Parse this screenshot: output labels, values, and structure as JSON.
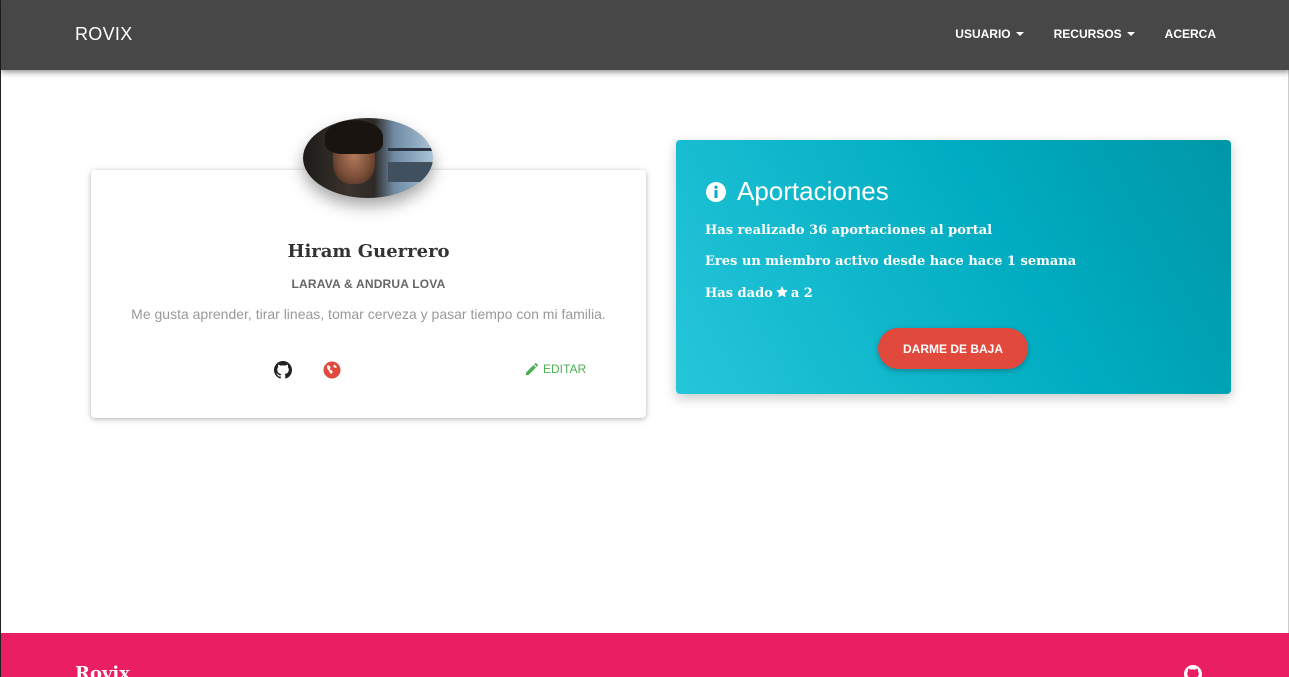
{
  "navbar": {
    "brand": "ROVIX",
    "items": [
      {
        "label": "USUARIO",
        "dropdown": true
      },
      {
        "label": "RECURSOS",
        "dropdown": true
      },
      {
        "label": "ACERCA",
        "dropdown": false
      }
    ]
  },
  "profile": {
    "name": "Hiram Guerrero",
    "role": "LARAVA & ANDRUA LOVA",
    "bio": "Me gusta aprender, tirar lineas, tomar cerveza y pasar tiempo con mi familia.",
    "links": [
      {
        "icon": "github-icon"
      },
      {
        "icon": "globe-icon",
        "color": "#e0493c"
      }
    ],
    "edit_label": "EDITAR",
    "edit_color": "#4caf50"
  },
  "aportaciones": {
    "title": "Aportaciones",
    "line1": "Has realizado 36 aportaciones al portal",
    "line2": "Eres un miembro activo desde hace hace 1 semana",
    "line3_prefix": "Has dado",
    "line3_suffix": "a 2",
    "button_label": "DARME DE BAJA",
    "button_color": "#e0493c",
    "card_color": "#00acc1"
  },
  "footer": {
    "brand": "Rovix",
    "color": "#e91e63",
    "icon": "github-icon"
  }
}
